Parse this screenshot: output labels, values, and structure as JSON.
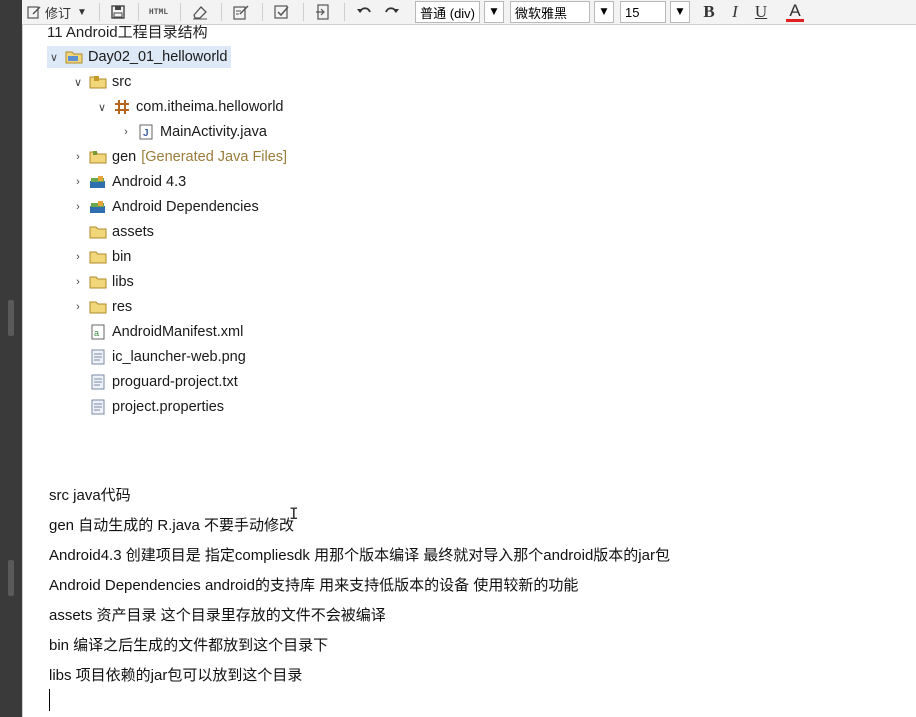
{
  "toolbar": {
    "revise_label": "修订",
    "paragraph_select": "普通 (div)",
    "font_select": "微软雅黑",
    "size_select": "15",
    "bold": "B",
    "italic": "I",
    "underline": "U",
    "font_color": "A",
    "font_color_accent": "#e02020"
  },
  "section_title": "11 Android工程目录结构",
  "tree": {
    "root": "Day02_01_helloworld",
    "src": "src",
    "package": "com.itheima.helloworld",
    "main_activity": "MainActivity.java",
    "gen": "gen",
    "gen_note": "[Generated Java Files]",
    "android": "Android 4.3",
    "android_deps": "Android Dependencies",
    "assets": "assets",
    "bin": "bin",
    "libs": "libs",
    "res": "res",
    "manifest": "AndroidManifest.xml",
    "launcher": "ic_launcher-web.png",
    "proguard": "proguard-project.txt",
    "properties": "project.properties"
  },
  "notes": [
    "src java代码",
    "gen 自动生成的 R.java 不要手动修改",
    "Android4.3 创建项目是 指定compliesdk 用那个版本编译 最终就对导入那个android版本的jar包",
    "Android Dependencies  android的支持库 用来支持低版本的设备 使用较新的功能",
    "assets 资产目录 这个目录里存放的文件不会被编译",
    "bin 编译之后生成的文件都放到这个目录下",
    "libs 项目依赖的jar包可以放到这个目录"
  ]
}
